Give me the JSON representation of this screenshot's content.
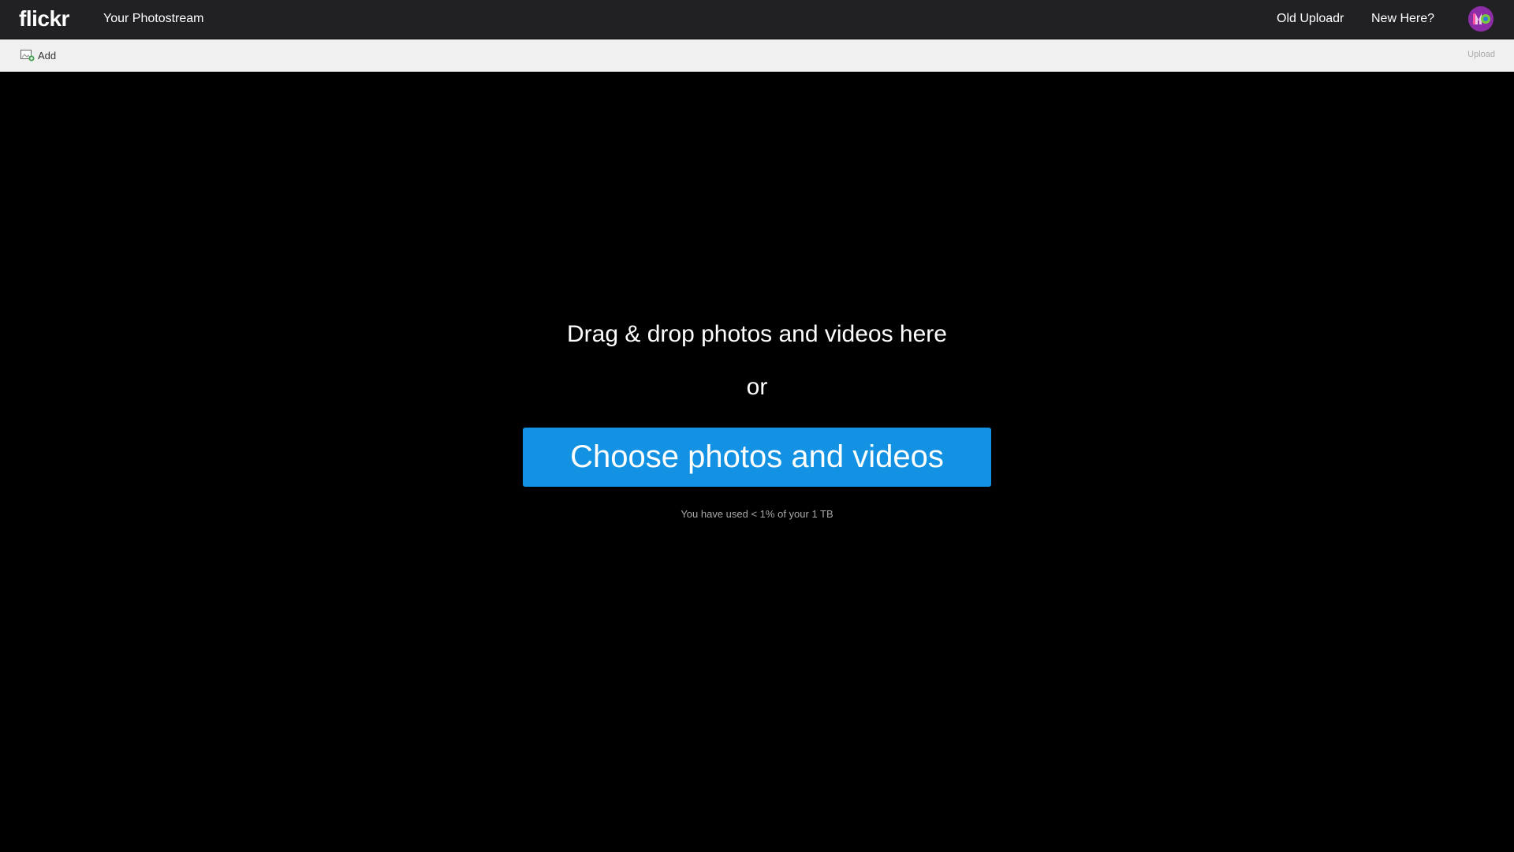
{
  "header": {
    "logo": "flickr",
    "nav_photostream": "Your Photostream",
    "nav_old_uploadr": "Old Uploadr",
    "nav_new_here": "New Here?",
    "avatar_icon": "user-avatar-icon"
  },
  "toolbar": {
    "add_label": "Add",
    "add_icon": "add-photo-icon",
    "upload_label": "Upload"
  },
  "dropzone": {
    "drag_text": "Drag & drop photos and videos here",
    "or_text": "or",
    "choose_button": "Choose photos and videos",
    "usage_text": "You have used < 1% of your 1 TB"
  },
  "colors": {
    "topbar_bg": "#212124",
    "toolbar_bg": "#f0f0f0",
    "page_bg": "#000000",
    "accent_blue": "#1391e2"
  }
}
